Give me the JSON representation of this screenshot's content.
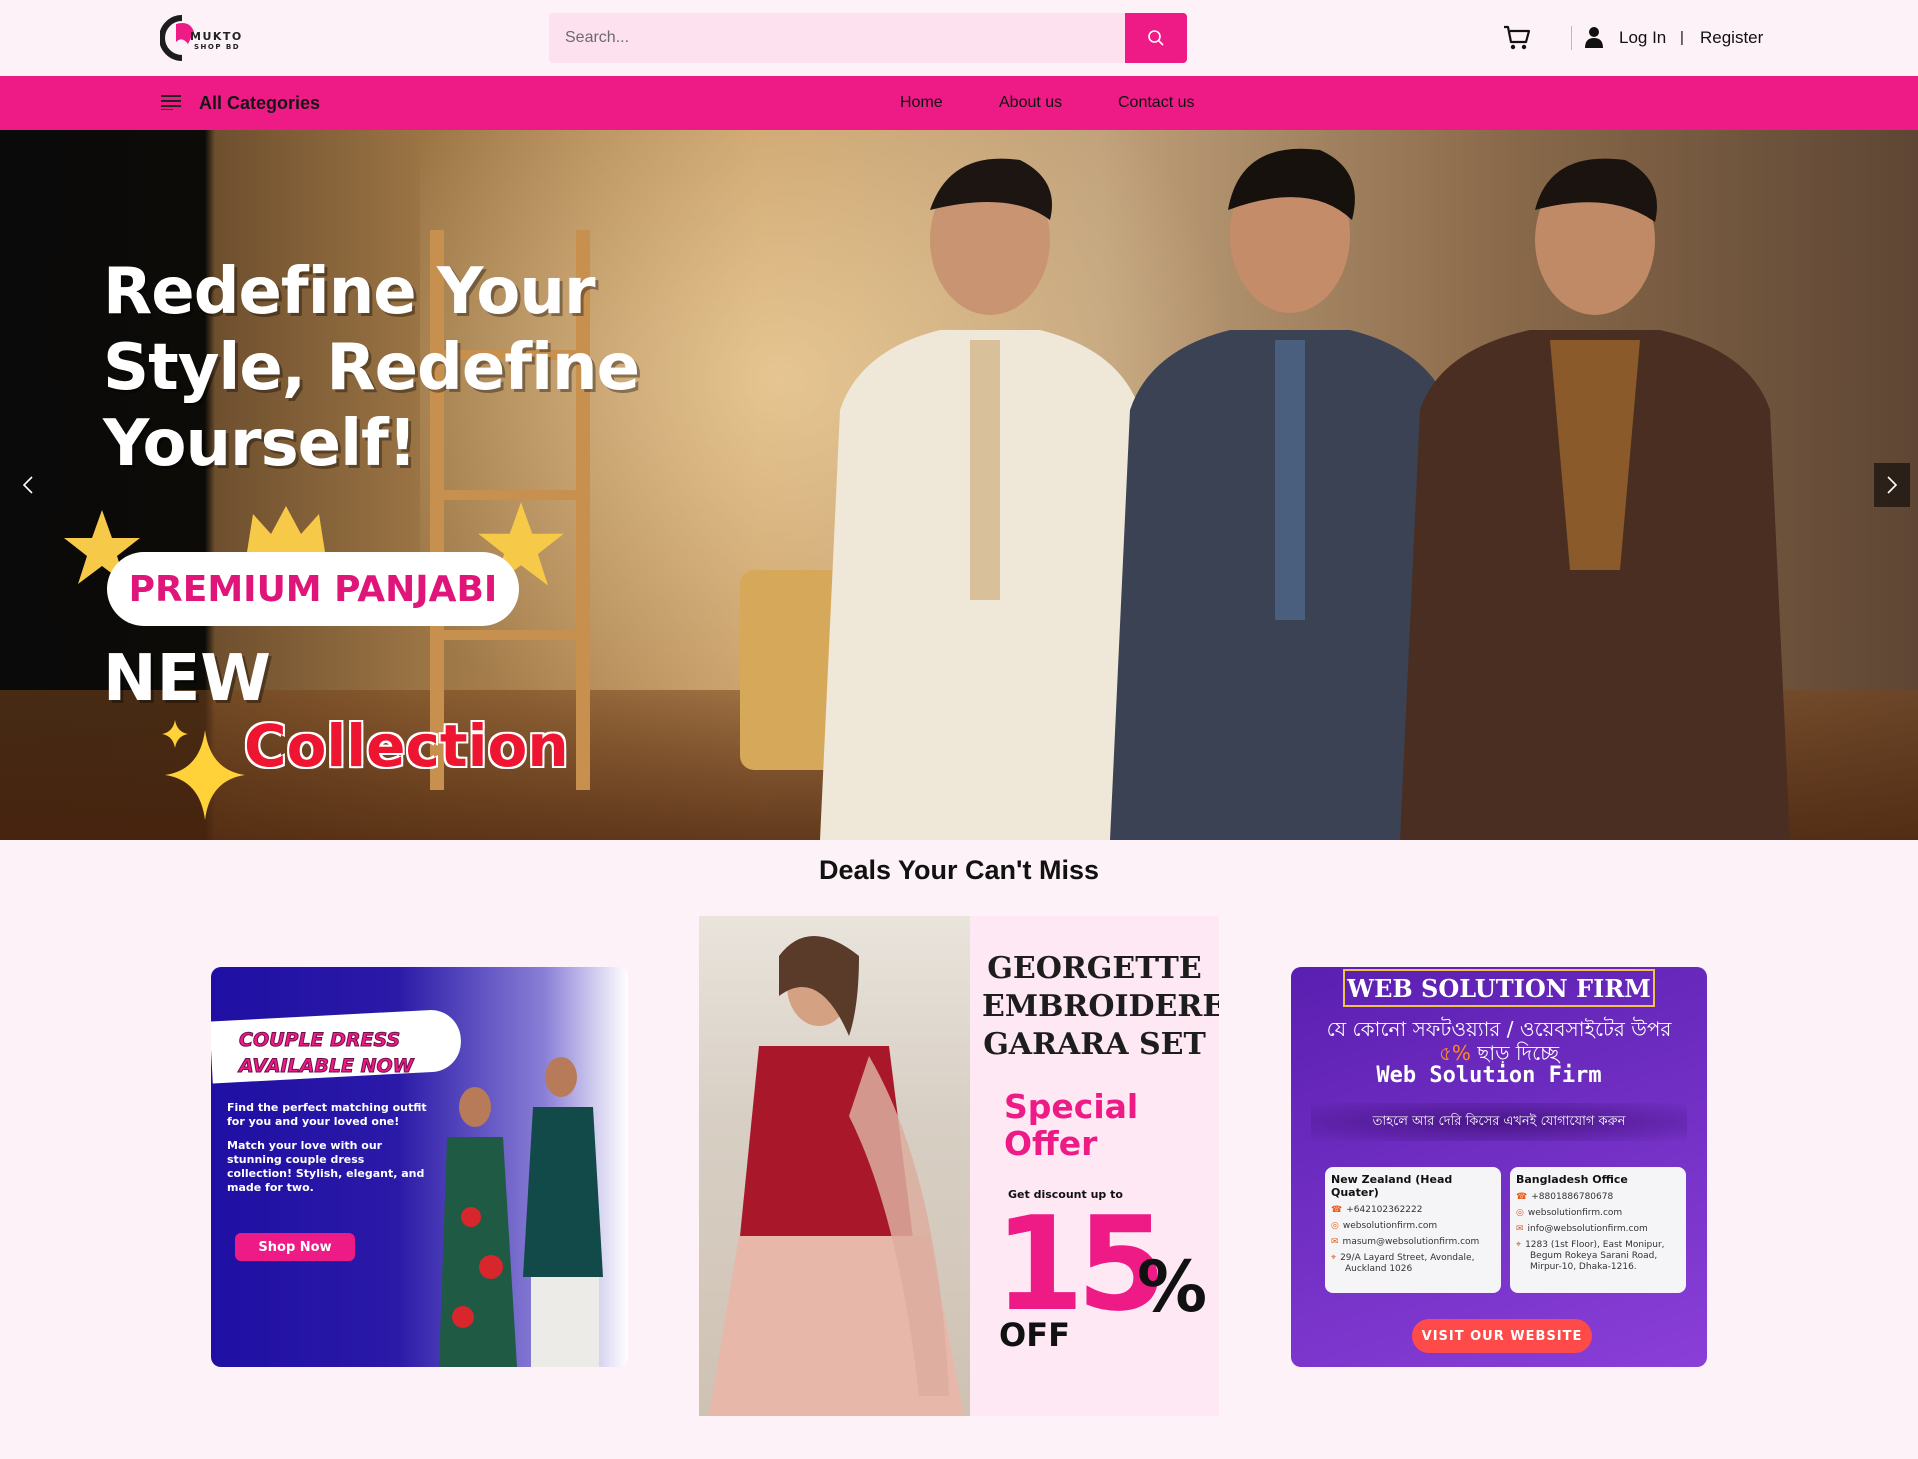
{
  "header": {
    "logo": {
      "line1": "MUKTO",
      "line2": "SHOP BD"
    },
    "search": {
      "placeholder": "Search..."
    },
    "login_label": "Log In",
    "separator": "|",
    "register_label": "Register"
  },
  "nav": {
    "categories_label": "All Categories",
    "links": [
      {
        "label": "Home"
      },
      {
        "label": "About us"
      },
      {
        "label": "Contact us"
      }
    ]
  },
  "hero": {
    "headline_lines": [
      "Redefine Your",
      "Style, Redefine",
      "Yourself!"
    ],
    "badge": "PREMIUM PANJABI",
    "new_label": "NEW",
    "collection_label": "Collection"
  },
  "deals": {
    "title": "Deals Your Can't Miss",
    "card1": {
      "headline_lines": [
        "COUPLE DRESS",
        "AVAILABLE NOW"
      ],
      "para1": "Find the perfect matching outfit for you and your loved one!",
      "para2": "Match your love with our stunning couple dress collection! Stylish, elegant, and made for two.",
      "button": "Shop Now"
    },
    "card2": {
      "title_lines": [
        "GEORGETTE",
        "EMBROIDERED",
        "GARARA SET"
      ],
      "offer_lines": [
        "Special",
        "Offer"
      ],
      "discount_caption": "Get discount up to",
      "discount_value": "15",
      "percent": "%",
      "off": "OFF"
    },
    "card3": {
      "title": "WEB SOLUTION FIRM",
      "bn_line1": "যে কোনো সফটওয়্যার / ওয়েবসাইটের উপর",
      "bn_line2_prefix": "৫%",
      "bn_line2_suffix": " ছাড় দিচ্ছে",
      "firm": "Web Solution Firm",
      "strip": "তাহলে আর দেরি কিসের এখনই যোগাযোগ করুন",
      "nz": {
        "heading": "New Zealand (Head Quater)",
        "phone": "+642102362222",
        "web": "websolutionfirm.com",
        "email": "masum@websolutionfirm.com",
        "addr1": "29/A Layard Street, Avondale,",
        "addr2": "Auckland 1026"
      },
      "bd": {
        "heading": "Bangladesh Office",
        "phone": "+8801886780678",
        "web": "websolutionfirm.com",
        "email": "info@websolutionfirm.com",
        "addr1": "1283 (1st Floor), East Monipur,",
        "addr2": "Begum Rokeya Sarani Road,",
        "addr3": "Mirpur-10, Dhaka-1216."
      },
      "button": "VISIT OUR WEBSITE"
    }
  },
  "colors": {
    "brand_pink": "#ee1a85",
    "nav_bg": "#ee1a85",
    "page_bg": "#fdf2f7",
    "search_bg": "#fde1ee"
  },
  "icons": [
    "logo-mark-icon",
    "search-icon",
    "cart-icon",
    "user-icon",
    "menu-icon",
    "chevron-left-icon",
    "chevron-right-icon",
    "star-icon",
    "crown-icon",
    "sparkle-icon"
  ]
}
